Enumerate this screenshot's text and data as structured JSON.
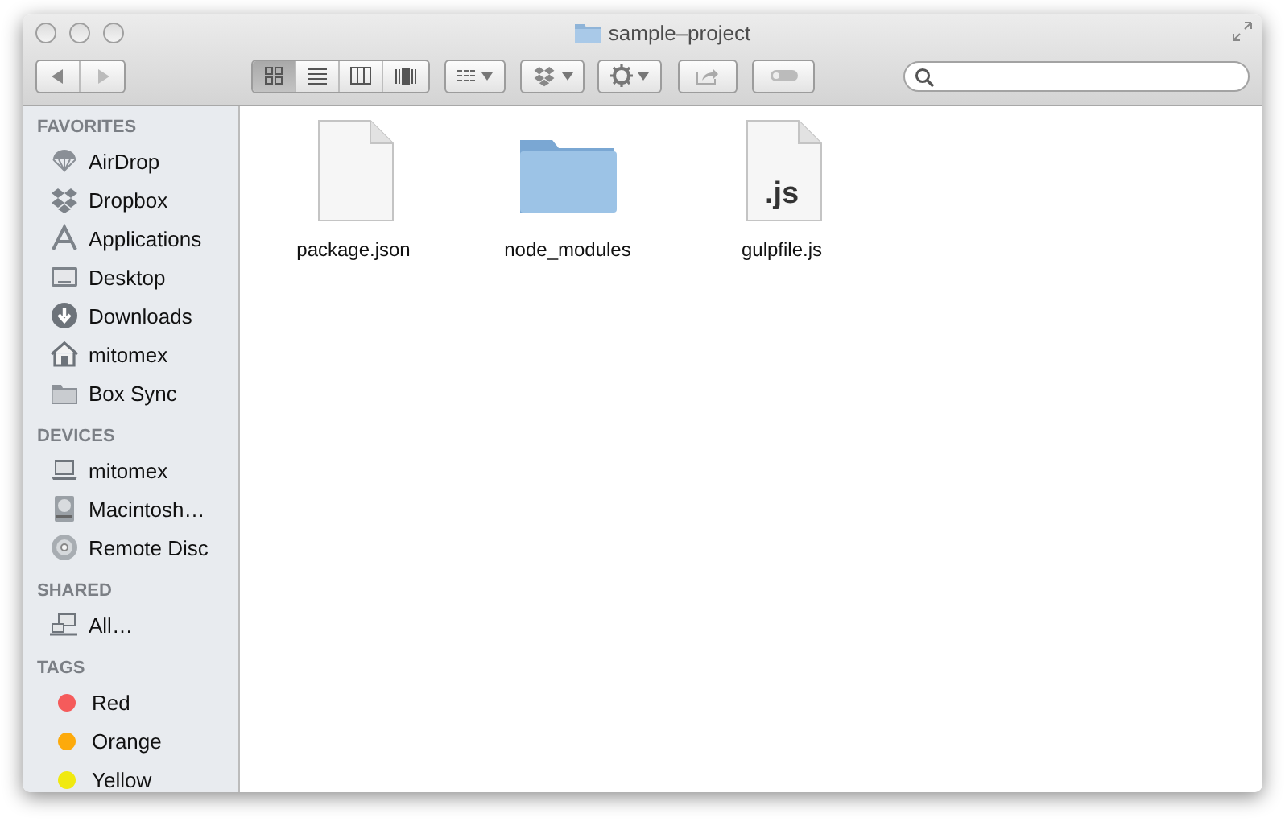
{
  "window": {
    "title": "sample–project"
  },
  "toolbar": {
    "view_buttons": [
      {
        "kind": "icons",
        "selected": true
      },
      {
        "kind": "list",
        "selected": false
      },
      {
        "kind": "columns",
        "selected": false
      },
      {
        "kind": "coverflow",
        "selected": false
      }
    ]
  },
  "sidebar": [
    {
      "title": "FAVORITES",
      "items": [
        {
          "kind": "airdrop",
          "label": "AirDrop"
        },
        {
          "kind": "dropbox",
          "label": "Dropbox"
        },
        {
          "kind": "applications",
          "label": "Applications"
        },
        {
          "kind": "desktop",
          "label": "Desktop"
        },
        {
          "kind": "downloads",
          "label": "Downloads"
        },
        {
          "kind": "home",
          "label": "mitomex"
        },
        {
          "kind": "folder",
          "label": "Box Sync"
        }
      ]
    },
    {
      "title": "DEVICES",
      "items": [
        {
          "kind": "laptop",
          "label": "mitomex"
        },
        {
          "kind": "disk",
          "label": "Macintosh…"
        },
        {
          "kind": "disc",
          "label": "Remote Disc"
        }
      ]
    },
    {
      "title": "SHARED",
      "items": [
        {
          "kind": "network",
          "label": "All…"
        }
      ]
    },
    {
      "title": "TAGS",
      "items": [
        {
          "kind": "tag",
          "label": "Red",
          "color": "#f55b5b"
        },
        {
          "kind": "tag",
          "label": "Orange",
          "color": "#fdaa0b"
        },
        {
          "kind": "tag",
          "label": "Yellow",
          "color": "#f0e90f"
        }
      ]
    }
  ],
  "files": [
    {
      "kind": "document",
      "name": "package.json"
    },
    {
      "kind": "folder",
      "name": "node_modules"
    },
    {
      "kind": "script",
      "name": "gulpfile.js",
      "badge": ".js"
    }
  ]
}
